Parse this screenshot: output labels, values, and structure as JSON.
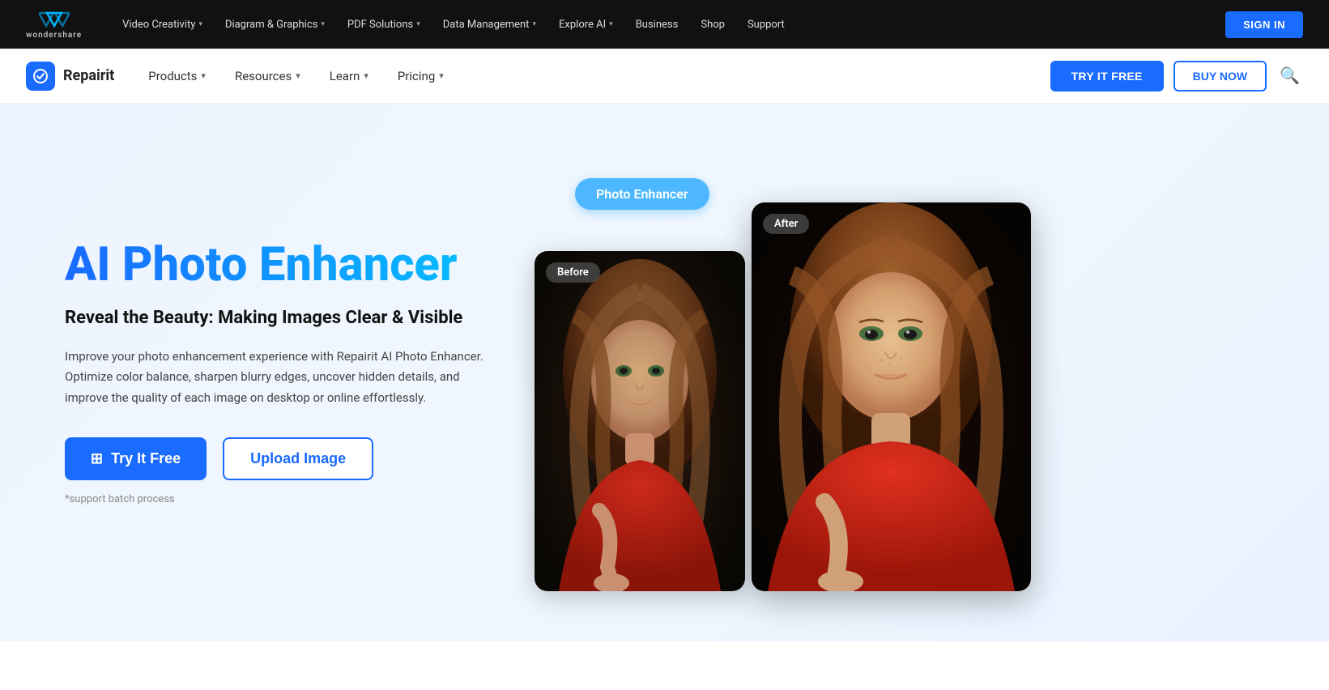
{
  "topnav": {
    "logo_mark": "❖",
    "logo_text": "wondershare",
    "items": [
      {
        "label": "Video Creativity",
        "has_chevron": true
      },
      {
        "label": "Diagram & Graphics",
        "has_chevron": true
      },
      {
        "label": "PDF Solutions",
        "has_chevron": true
      },
      {
        "label": "Data Management",
        "has_chevron": true
      },
      {
        "label": "Explore AI",
        "has_chevron": true
      },
      {
        "label": "Business"
      },
      {
        "label": "Shop"
      },
      {
        "label": "Support"
      }
    ],
    "sign_in_label": "SIGN IN"
  },
  "productnav": {
    "product_name": "Repairit",
    "items": [
      {
        "label": "Products",
        "has_chevron": true
      },
      {
        "label": "Resources",
        "has_chevron": true
      },
      {
        "label": "Learn",
        "has_chevron": true
      },
      {
        "label": "Pricing",
        "has_chevron": true
      }
    ],
    "try_free_label": "TRY IT FREE",
    "buy_now_label": "BUY NOW"
  },
  "hero": {
    "badge": "Photo Enhancer",
    "title": "AI Photo Enhancer",
    "subtitle": "Reveal the Beauty: Making Images Clear & Visible",
    "description": "Improve your photo enhancement experience with Repairit AI Photo Enhancer. Optimize color balance, sharpen blurry edges, uncover hidden details, and improve the quality of each image on desktop or online effortlessly.",
    "try_btn": "Try It Free",
    "upload_btn": "Upload Image",
    "note": "*support batch process",
    "before_label": "Before",
    "after_label": "After"
  }
}
